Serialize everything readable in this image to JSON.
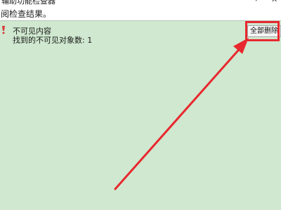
{
  "window": {
    "title": "辅助功能检查器",
    "menu_glyph": "▾",
    "close_glyph": "✕"
  },
  "header": {
    "text": "阅检查结果。"
  },
  "results": {
    "category": "不可见内容",
    "found_text": "找到的不可见对象数: 1"
  },
  "actions": {
    "delete_all_label": "全部删除"
  },
  "icons": {
    "warning": "warning-icon"
  },
  "colors": {
    "pane_bg": "#cfe8cf",
    "annotation": "#e8282f",
    "warning": "#d83a3a"
  }
}
